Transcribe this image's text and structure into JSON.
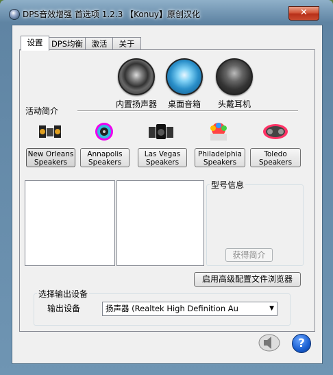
{
  "window": {
    "title": "DPS音效增强 首选项 1.2.3 【Konuy】原创汉化",
    "close_glyph": "✕"
  },
  "tabs": [
    {
      "label": "设置",
      "active": true
    },
    {
      "label": "DPS均衡",
      "active": false
    },
    {
      "label": "激活",
      "active": false
    },
    {
      "label": "关于",
      "active": false
    }
  ],
  "modes": [
    {
      "label": "内置扬声器",
      "icon": "builtin-speaker-icon"
    },
    {
      "label": "桌面音箱",
      "icon": "desktop-speakers-icon"
    },
    {
      "label": "头戴耳机",
      "icon": "headphones-icon"
    }
  ],
  "activity_label": "活动简介",
  "speakers": [
    {
      "line1": "New Orleans",
      "line2": "Speakers",
      "selected": true,
      "icon": "new-orleans-speakers-icon"
    },
    {
      "line1": "Annapolis",
      "line2": "Speakers",
      "selected": false,
      "icon": "annapolis-speakers-icon"
    },
    {
      "line1": "Las Vegas",
      "line2": "Speakers",
      "selected": false,
      "icon": "las-vegas-speakers-icon"
    },
    {
      "line1": "Philadelphia",
      "line2": "Speakers",
      "selected": false,
      "icon": "philadelphia-speakers-icon"
    },
    {
      "line1": "Toledo",
      "line2": "Speakers",
      "selected": false,
      "icon": "toledo-speakers-icon"
    }
  ],
  "model_info": {
    "title": "型号信息",
    "get_info_button": "获得简介"
  },
  "advanced_button": "启用高级配置文件浏览器",
  "output": {
    "group_title": "选择输出设备",
    "device_label": "输出设备",
    "selected_device": "扬声器 (Realtek High Definition Au"
  },
  "colors": {
    "accent_blue": "#1a5fd1",
    "close_red": "#c94a2e"
  }
}
